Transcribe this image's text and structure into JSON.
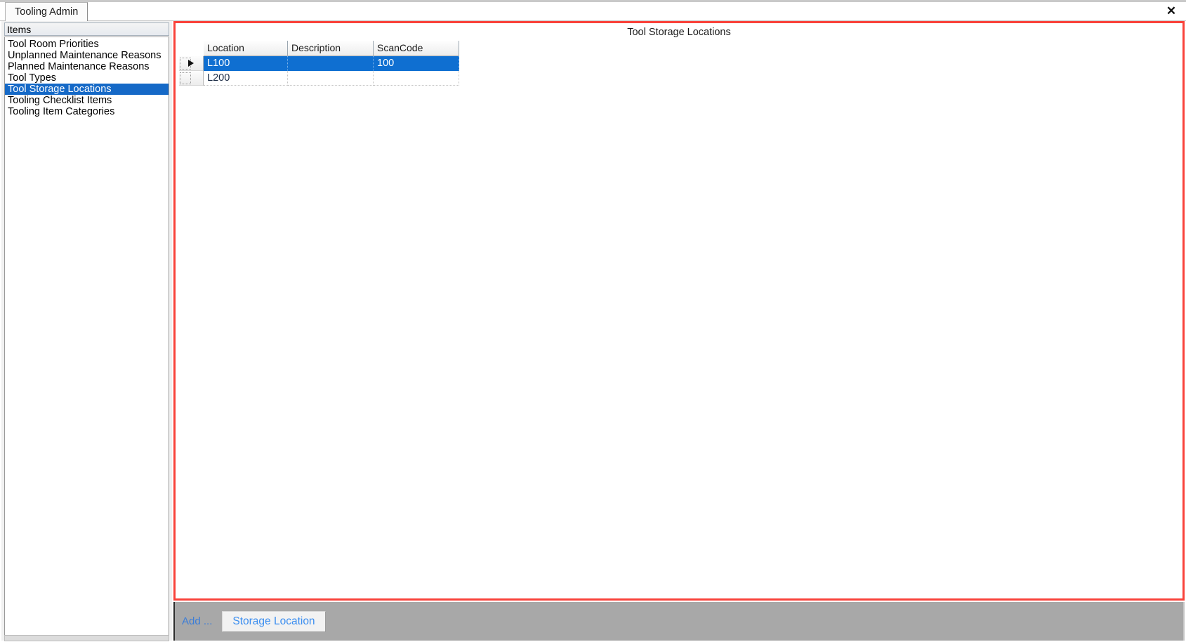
{
  "window": {
    "close_label": "✕"
  },
  "tabs": [
    {
      "label": "Tooling Admin",
      "active": true
    }
  ],
  "sidebar": {
    "header": "Items",
    "items": [
      {
        "label": "Tool Room Priorities",
        "selected": false
      },
      {
        "label": "Unplanned Maintenance Reasons",
        "selected": false
      },
      {
        "label": "Planned Maintenance Reasons",
        "selected": false
      },
      {
        "label": "Tool Types",
        "selected": false
      },
      {
        "label": "Tool Storage Locations",
        "selected": true
      },
      {
        "label": "Tooling Checklist Items",
        "selected": false
      },
      {
        "label": "Tooling Item Categories",
        "selected": false
      }
    ]
  },
  "main": {
    "title": "Tool Storage Locations",
    "grid": {
      "columns": [
        "Location",
        "Description",
        "ScanCode"
      ],
      "rows": [
        {
          "Location": "L100",
          "Description": "",
          "ScanCode": "100",
          "selected": true,
          "current": true
        },
        {
          "Location": "L200",
          "Description": "",
          "ScanCode": "",
          "selected": false,
          "current": false
        }
      ]
    }
  },
  "actionbar": {
    "add_label": "Add ...",
    "storage_location_button": "Storage Location"
  },
  "colors": {
    "selection_blue": "#0f6fd1",
    "sidebar_selection_blue": "#1569c7",
    "panel_border_red": "#f9423a",
    "actionbar_gray": "#a8a8a8",
    "link_blue": "#3b8ef0"
  }
}
